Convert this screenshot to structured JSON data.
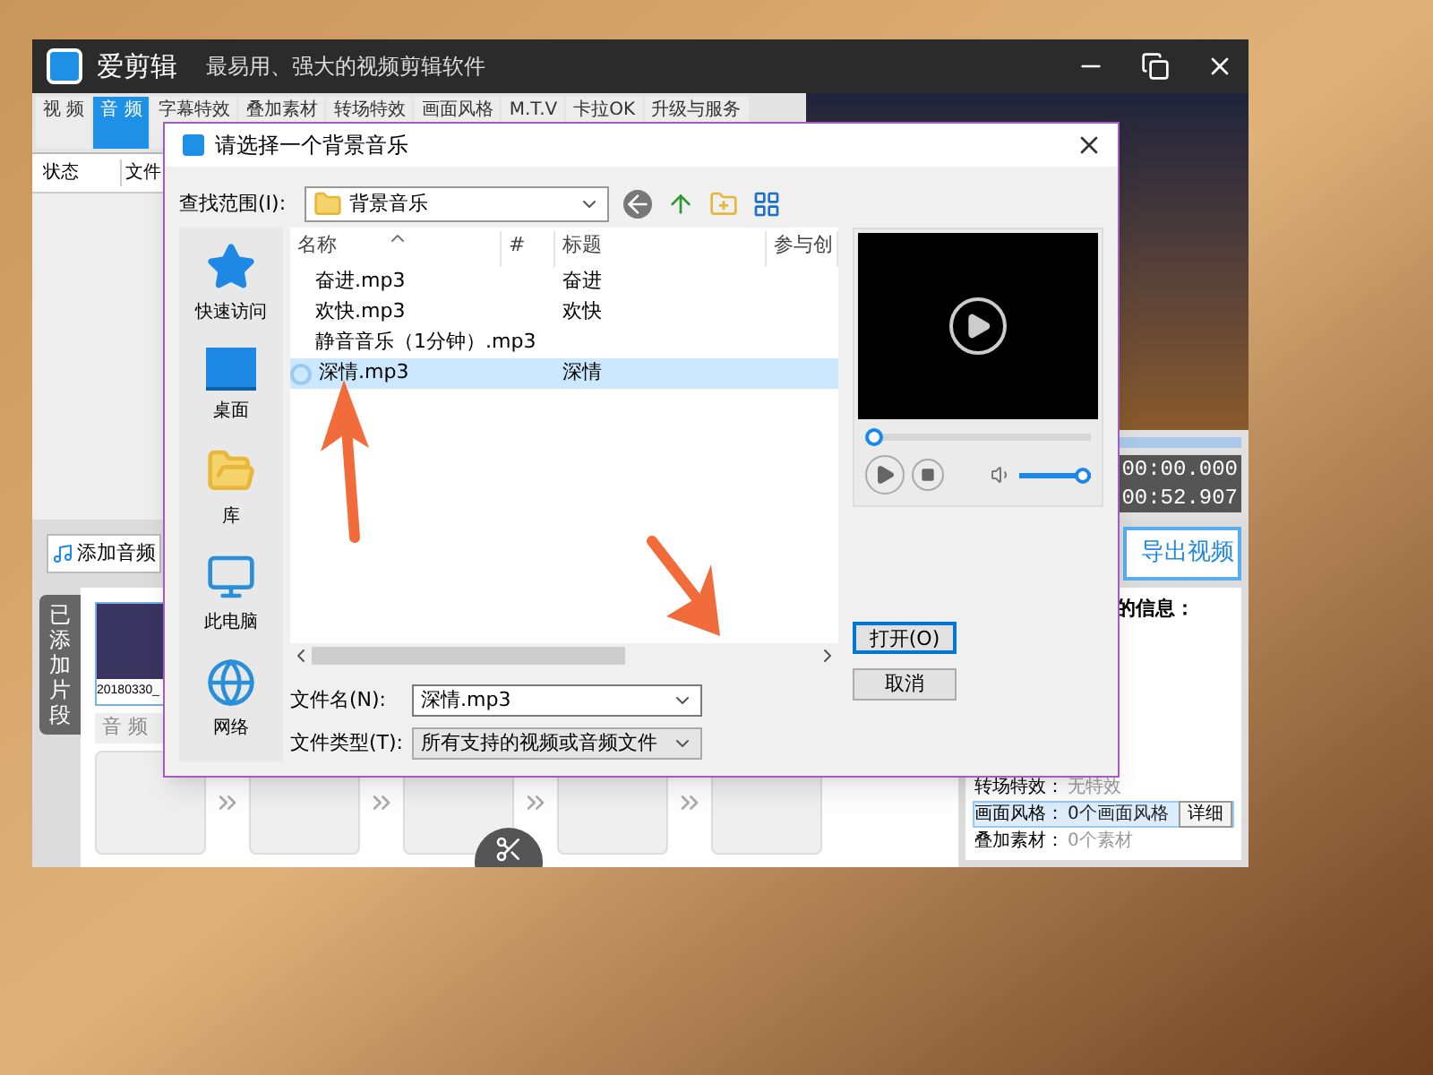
{
  "app": {
    "title": "爱剪辑",
    "subtitle": "最易用、强大的视频剪辑软件",
    "tabs": [
      {
        "label": "视 频",
        "selected": false
      },
      {
        "label": "音 频",
        "selected": true
      },
      {
        "label": "字幕特效",
        "selected": false
      },
      {
        "label": "叠加素材",
        "selected": false
      },
      {
        "label": "转场特效",
        "selected": false
      },
      {
        "label": "画面风格",
        "selected": false
      },
      {
        "label": "M.T.V",
        "selected": false
      },
      {
        "label": "卡拉OK",
        "selected": false
      },
      {
        "label": "升级与服务",
        "selected": false
      }
    ],
    "list_columns": [
      "状态",
      "文件"
    ],
    "progress": {
      "level": 1
    },
    "times": [
      "00:00.000",
      "00:52.907"
    ],
    "export_button": "导出视频",
    "info_title": "的信息：",
    "info_rows": [
      {
        "label": "转场特效：",
        "value": "无特效",
        "selected": false
      },
      {
        "label": "画面风格：",
        "value": "0个画面风格",
        "selected": true,
        "button": "详细"
      },
      {
        "label": "叠加素材：",
        "value": "0个素材",
        "selected": false
      }
    ],
    "add_audio_button": "添加音频",
    "side_tab": "已添加片段",
    "clips": [
      {
        "name": "20180330_"
      }
    ],
    "track_label": "音 频"
  },
  "dialog": {
    "title": "请选择一个背景音乐",
    "look_in_label": "查找范围(I):",
    "look_in_value": "背景音乐",
    "places": [
      {
        "label": "快速访问",
        "kind": "star"
      },
      {
        "label": "桌面",
        "kind": "desktop"
      },
      {
        "label": "库",
        "kind": "library"
      },
      {
        "label": "此电脑",
        "kind": "computer"
      },
      {
        "label": "网络",
        "kind": "network"
      }
    ],
    "columns": [
      "名称",
      "#",
      "标题",
      "参与创"
    ],
    "files": [
      {
        "name": "奋进.mp3",
        "title": "奋进",
        "selected": false
      },
      {
        "name": "欢快.mp3",
        "title": "欢快",
        "selected": false
      },
      {
        "name": "静音音乐（1分钟）.mp3",
        "selected": false
      },
      {
        "name": "深情.mp3",
        "title": "深情",
        "selected": true
      }
    ],
    "filename_label": "文件名(N):",
    "filename": "深情.mp3",
    "filetype_label": "文件类型(T):",
    "filetype": "所有支持的视频或音频文件",
    "buttons": [
      {
        "label": "打开(O)",
        "kind": "primary"
      },
      {
        "label": "取消",
        "kind": "normal"
      }
    ],
    "seek": {
      "level": 0
    },
    "volume": {
      "level": 1
    }
  }
}
